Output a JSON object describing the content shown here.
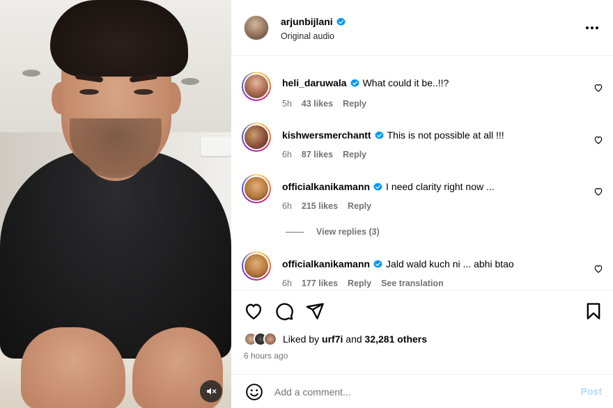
{
  "colors": {
    "verified": "#0095f6",
    "post_disabled": "#b3dbff",
    "meta_text": "#737373"
  },
  "icons": {
    "mute": "speaker-muted-icon",
    "more": "more-horizontal-icon",
    "verified": "verified-badge-icon",
    "like": "heart-icon",
    "comment": "comment-bubble-icon",
    "share": "paper-plane-icon",
    "save": "bookmark-icon",
    "emoji": "smiley-icon"
  },
  "post": {
    "author": "arjunbijlani",
    "audio": "Original audio"
  },
  "comments": [
    {
      "user": "heli_daruwala",
      "text": "What could it be..!!?",
      "time": "5h",
      "likes": "43 likes",
      "reply": "Reply"
    },
    {
      "user": "kishwersmerchantt",
      "text": "This is not possible at all !!!",
      "time": "6h",
      "likes": "87 likes",
      "reply": "Reply"
    },
    {
      "user": "officialkanikamann",
      "text": "I need clarity right now ...",
      "time": "6h",
      "likes": "215 likes",
      "reply": "Reply",
      "view_replies": "View replies (3)"
    },
    {
      "user": "officialkanikamann",
      "text": "Jald wald kuch ni ... abhi btao",
      "time": "6h",
      "likes": "177 likes",
      "reply": "Reply",
      "see_translation": "See translation"
    }
  ],
  "likes_summary": {
    "prefix": "Liked by",
    "user": "urf7i",
    "and": "and",
    "others": "32,281 others"
  },
  "time_ago": "6 hours ago",
  "add_comment": {
    "placeholder": "Add a comment...",
    "post_label": "Post"
  }
}
